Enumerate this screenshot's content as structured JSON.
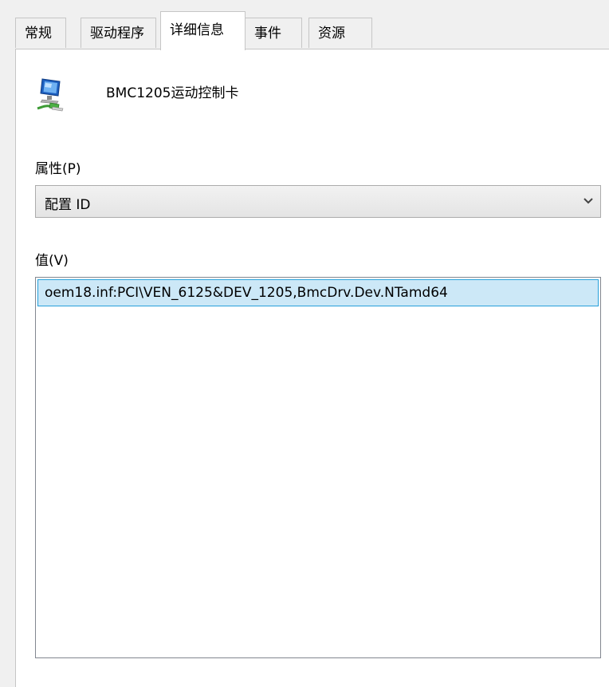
{
  "tabs": [
    {
      "label": "常规"
    },
    {
      "label": "驱动程序"
    },
    {
      "label": "详细信息"
    },
    {
      "label": "事件"
    },
    {
      "label": "资源"
    }
  ],
  "active_tab": "详细信息",
  "device": {
    "name": "BMC1205运动控制卡",
    "icon": "network-adapter-icon"
  },
  "property": {
    "label": "属性(P)",
    "selected": "配置 ID"
  },
  "value": {
    "label": "值(V)",
    "items": [
      "oem18.inf:PCI\\VEN_6125&DEV_1205,BmcDrv.Dev.NTamd64"
    ]
  },
  "colors": {
    "selection_bg": "#cce8f7",
    "selection_border": "#26a0da"
  }
}
